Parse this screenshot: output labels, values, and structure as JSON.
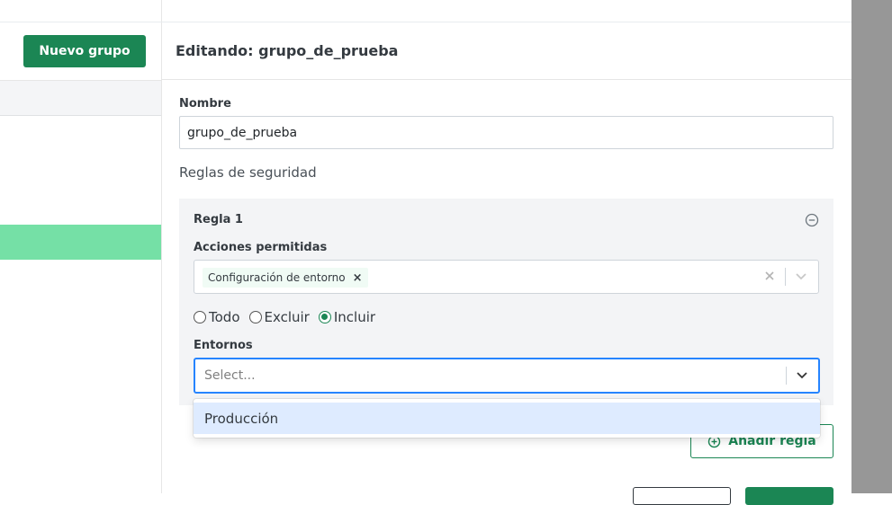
{
  "sidebar": {
    "new_group_label": "Nuevo grupo"
  },
  "modal": {
    "title": "Editando: grupo_de_prueba",
    "name_label": "Nombre",
    "name_value": "grupo_de_prueba",
    "rules_section_title": "Reglas de seguridad",
    "rule": {
      "title": "Regla 1",
      "actions_label": "Acciones permitidas",
      "selected_actions": [
        "Configuración de entorno"
      ],
      "scope_options": [
        {
          "label": "Todo",
          "checked": false
        },
        {
          "label": "Excluir",
          "checked": false
        },
        {
          "label": "Incluir",
          "checked": true
        }
      ],
      "environments_label": "Entornos",
      "environments_placeholder": "Select...",
      "environment_options": [
        "Producción"
      ]
    },
    "add_rule_label": "Añadir regla"
  },
  "colors": {
    "primary": "#1b8654",
    "selected_row": "#75e0a6",
    "focus_border": "#2684ff",
    "option_highlight": "#deebff",
    "overlay": "#979797"
  }
}
